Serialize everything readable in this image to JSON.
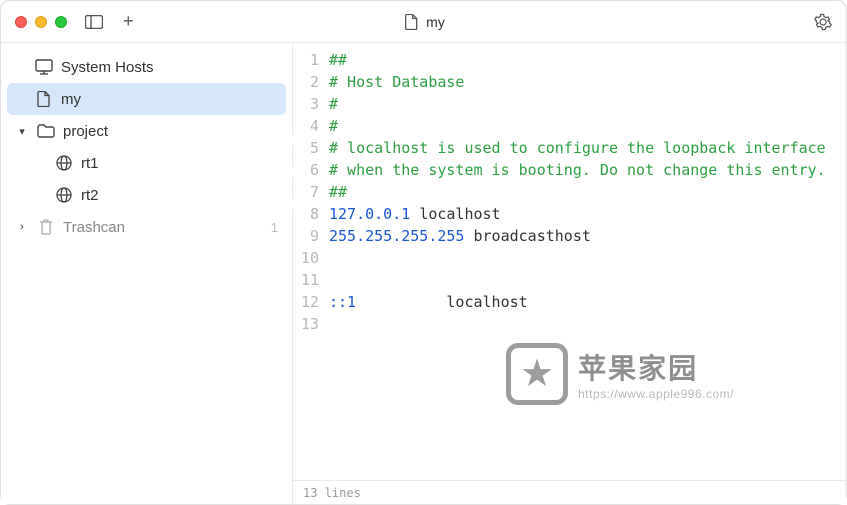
{
  "titlebar": {
    "title": "my"
  },
  "sidebar": {
    "system_hosts": "System Hosts",
    "my": "my",
    "project": "project",
    "rt1": "rt1",
    "rt2": "rt2",
    "trashcan": "Trashcan",
    "trashcan_count": "1",
    "toggles": {
      "my": true,
      "project": false,
      "rt1": false,
      "rt2": false
    }
  },
  "editor": {
    "lines": [
      {
        "n": 1,
        "segs": [
          {
            "cls": "c-comment",
            "t": "##"
          }
        ]
      },
      {
        "n": 2,
        "segs": [
          {
            "cls": "c-comment",
            "t": "# Host Database"
          }
        ]
      },
      {
        "n": 3,
        "segs": [
          {
            "cls": "c-comment",
            "t": "#"
          }
        ]
      },
      {
        "n": 4,
        "segs": [
          {
            "cls": "c-comment",
            "t": "#"
          }
        ]
      },
      {
        "n": 5,
        "segs": [
          {
            "cls": "c-comment",
            "t": "# localhost is used to configure the loopback interface"
          }
        ]
      },
      {
        "n": 6,
        "segs": [
          {
            "cls": "c-comment",
            "t": "# when the system is booting. Do not change this entry."
          }
        ]
      },
      {
        "n": 7,
        "segs": [
          {
            "cls": "c-comment",
            "t": "##"
          }
        ]
      },
      {
        "n": 8,
        "segs": [
          {
            "cls": "c-ip",
            "t": "127.0.0.1 "
          },
          {
            "cls": "c-host",
            "t": "localhost"
          }
        ]
      },
      {
        "n": 9,
        "segs": [
          {
            "cls": "c-ip",
            "t": "255.255.255.255 "
          },
          {
            "cls": "c-host",
            "t": "broadcasthost"
          }
        ]
      },
      {
        "n": 10,
        "segs": [
          {
            "cls": "",
            "t": ""
          }
        ]
      },
      {
        "n": 11,
        "segs": [
          {
            "cls": "",
            "t": ""
          }
        ]
      },
      {
        "n": 12,
        "segs": [
          {
            "cls": "c-ip",
            "t": "::1          "
          },
          {
            "cls": "c-host",
            "t": "localhost"
          }
        ]
      },
      {
        "n": 13,
        "segs": [
          {
            "cls": "",
            "t": ""
          }
        ]
      }
    ]
  },
  "statusbar": {
    "text": "13 lines"
  },
  "watermark": {
    "big": "苹果家园",
    "url": "https://www.apple996.com/"
  }
}
